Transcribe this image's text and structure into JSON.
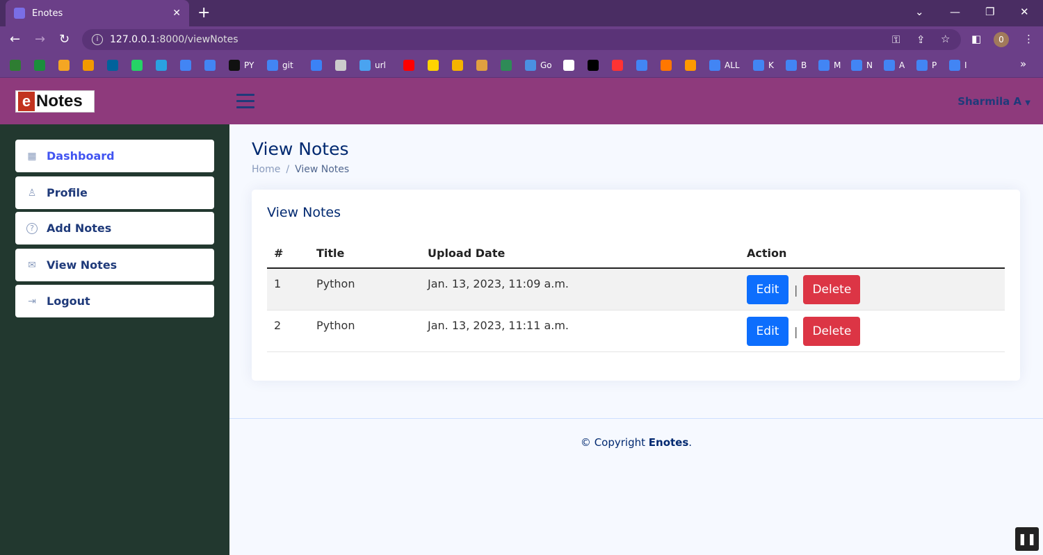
{
  "browser": {
    "tab_title": "Enotes",
    "url_host": "127.0.0.1",
    "url_path": ":8000/viewNotes",
    "profile_initial": "0",
    "bookmarks": [
      {
        "label": "",
        "color": "#2e7d32"
      },
      {
        "label": "",
        "color": "#1b8e3c"
      },
      {
        "label": "",
        "color": "#f4a623"
      },
      {
        "label": "",
        "color": "#f29900"
      },
      {
        "label": "",
        "color": "#00629b"
      },
      {
        "label": "",
        "color": "#25d366"
      },
      {
        "label": "",
        "color": "#2aa1e0"
      },
      {
        "label": "",
        "color": "#4285f4"
      },
      {
        "label": "",
        "color": "#4285f4"
      },
      {
        "label": "PY",
        "color": "#111111"
      },
      {
        "label": "git",
        "color": "#4285f4"
      },
      {
        "label": "",
        "color": "#3b82f6"
      },
      {
        "label": "",
        "color": "#cccccc"
      },
      {
        "label": "url",
        "color": "#4aa3f0"
      },
      {
        "label": "",
        "color": "#ff0000"
      },
      {
        "label": "",
        "color": "#ffd400"
      },
      {
        "label": "",
        "color": "#f4b400"
      },
      {
        "label": "",
        "color": "#e0a040"
      },
      {
        "label": "",
        "color": "#2e8b57"
      },
      {
        "label": "Go",
        "color": "#4a90e2"
      },
      {
        "label": "",
        "color": "#ffffff"
      },
      {
        "label": "",
        "color": "#000000"
      },
      {
        "label": "",
        "color": "#ff3333"
      },
      {
        "label": "",
        "color": "#4285f4"
      },
      {
        "label": "",
        "color": "#ff7700"
      },
      {
        "label": "",
        "color": "#ff9900"
      },
      {
        "label": "ALL",
        "color": "#4285f4"
      },
      {
        "label": "K",
        "color": "#4285f4"
      },
      {
        "label": "B",
        "color": "#4285f4"
      },
      {
        "label": "M",
        "color": "#4285f4"
      },
      {
        "label": "N",
        "color": "#4285f4"
      },
      {
        "label": "A",
        "color": "#4285f4"
      },
      {
        "label": "P",
        "color": "#4285f4"
      },
      {
        "label": "I",
        "color": "#4285f4"
      }
    ]
  },
  "header": {
    "logo_e": "e",
    "logo_rest": "Notes",
    "user_name": "Sharmila A"
  },
  "sidebar": {
    "items": [
      {
        "label": "Dashboard",
        "icon": "grid-icon",
        "glyph": "▦"
      },
      {
        "label": "Profile",
        "icon": "person-icon",
        "glyph": "♙"
      },
      {
        "label": "Add Notes",
        "icon": "question-circle-icon",
        "glyph": "?"
      },
      {
        "label": "View Notes",
        "icon": "envelope-icon",
        "glyph": "✉"
      },
      {
        "label": "Logout",
        "icon": "box-arrow-in-right-icon",
        "glyph": "⇥"
      }
    ]
  },
  "main": {
    "page_title": "View Notes",
    "breadcrumb": {
      "home": "Home",
      "separator": "/",
      "current": "View Notes"
    },
    "card_title": "View Notes",
    "table": {
      "headers": {
        "num": "#",
        "title": "Title",
        "date": "Upload Date",
        "action": "Action"
      },
      "rows": [
        {
          "num": "1",
          "title": "Python",
          "date": "Jan. 13, 2023, 11:09 a.m.",
          "edit": "Edit",
          "sep": "|",
          "delete": "Delete"
        },
        {
          "num": "2",
          "title": "Python",
          "date": "Jan. 13, 2023, 11:11 a.m.",
          "edit": "Edit",
          "sep": "|",
          "delete": "Delete"
        }
      ]
    }
  },
  "footer": {
    "prefix": "© Copyright ",
    "brand": "Enotes",
    "suffix": "."
  },
  "colors": {
    "header_bg": "#8e3a7c",
    "sidebar_bg": "#22382f",
    "edit_btn": "#0d6efd",
    "delete_btn": "#dc3545",
    "title_color": "#012970"
  }
}
